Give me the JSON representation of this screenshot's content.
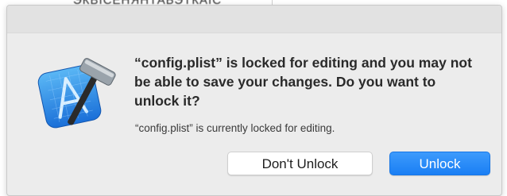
{
  "background": {
    "partial_text": "ЭКВІСЕНЯНТАБЭТКАІС"
  },
  "dialog": {
    "app_icon": "xcode-icon",
    "title": "“config.plist” is locked for editing and you may not be able to save your changes. Do you want to unlock it?",
    "message": "“config.plist” is currently locked for editing.",
    "buttons": {
      "dont_unlock": "Don't Unlock",
      "unlock": "Unlock"
    }
  },
  "colors": {
    "primary_button": "#1a7ff4",
    "dialog_background": "#ececec"
  }
}
